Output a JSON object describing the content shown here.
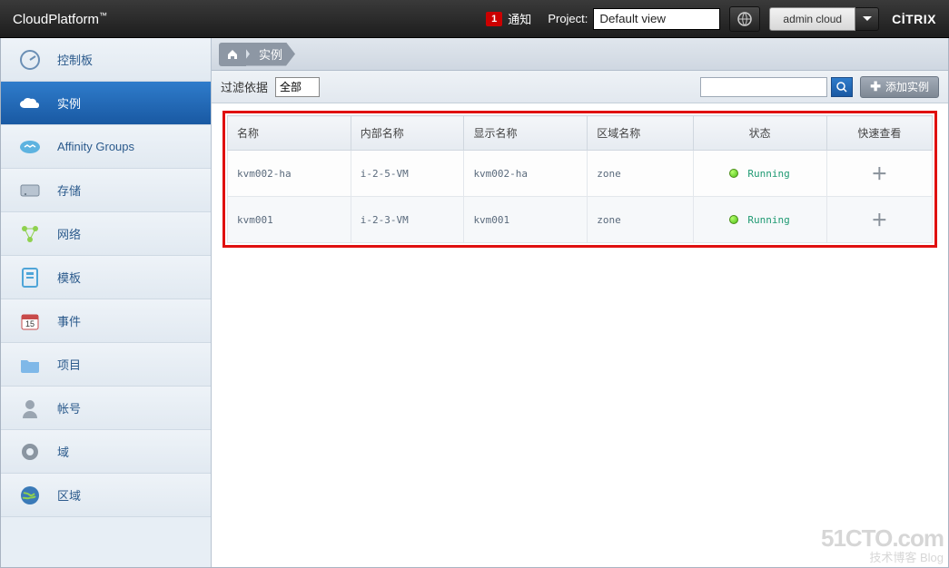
{
  "topbar": {
    "brand": "CloudPlatform",
    "brand_tm": "™",
    "notif_count": "1",
    "notif_label": "通知",
    "project_label": "Project:",
    "project_value": "Default view",
    "user": "admin cloud",
    "vendor": "CİTRIX"
  },
  "sidebar": {
    "items": [
      {
        "label": "控制板"
      },
      {
        "label": "实例"
      },
      {
        "label": "Affinity Groups"
      },
      {
        "label": "存储"
      },
      {
        "label": "网络"
      },
      {
        "label": "模板"
      },
      {
        "label": "事件"
      },
      {
        "label": "项目"
      },
      {
        "label": "帐号"
      },
      {
        "label": "域"
      },
      {
        "label": "区域"
      }
    ]
  },
  "breadcrumb": {
    "current": "实例"
  },
  "filter": {
    "label": "过滤依据",
    "value": "全部",
    "add_button": "添加实例"
  },
  "table": {
    "headers": [
      "名称",
      "内部名称",
      "显示名称",
      "区域名称",
      "状态",
      "快速查看"
    ],
    "rows": [
      {
        "name": "kvm002-ha",
        "internal": "i-2-5-VM",
        "display": "kvm002-ha",
        "zone": "zone",
        "status": "Running"
      },
      {
        "name": "kvm001",
        "internal": "i-2-3-VM",
        "display": "kvm001",
        "zone": "zone",
        "status": "Running"
      }
    ]
  },
  "watermark": {
    "line1": "51CTO.com",
    "line2": "技术博客  Blog"
  }
}
